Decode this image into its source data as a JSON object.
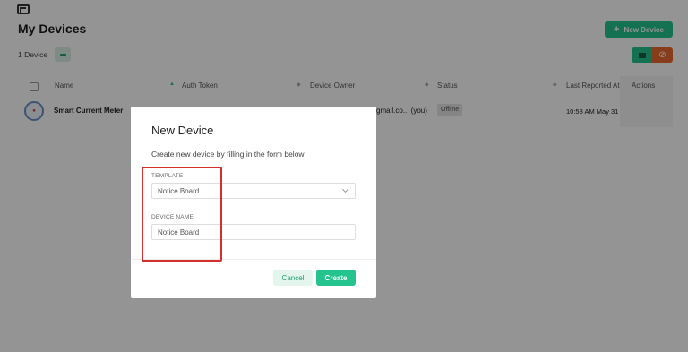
{
  "page": {
    "title": "My Devices",
    "device_count": "1 Device",
    "more_label": "•••",
    "new_device_label": "New Device",
    "new_device_icon": "plus-icon"
  },
  "table": {
    "columns": [
      "Name",
      "Auth Token",
      "Device Owner",
      "Status",
      "Last Reported At",
      "Actions"
    ],
    "rows": [
      {
        "name": "Smart Current Meter",
        "owner": "gmail.co... (you)",
        "status": "Offline",
        "last_reported": "10:58 AM May 31"
      }
    ]
  },
  "modal": {
    "title": "New Device",
    "subtitle": "Create new device by filling in the form below",
    "template_label": "TEMPLATE",
    "template_value": "Notice Board",
    "device_name_label": "DEVICE NAME",
    "device_name_value": "Notice Board",
    "cancel_label": "Cancel",
    "create_label": "Create"
  },
  "colors": {
    "accent": "#23c48e",
    "highlight": "#d32f2f",
    "secondary": "#e8692d"
  }
}
